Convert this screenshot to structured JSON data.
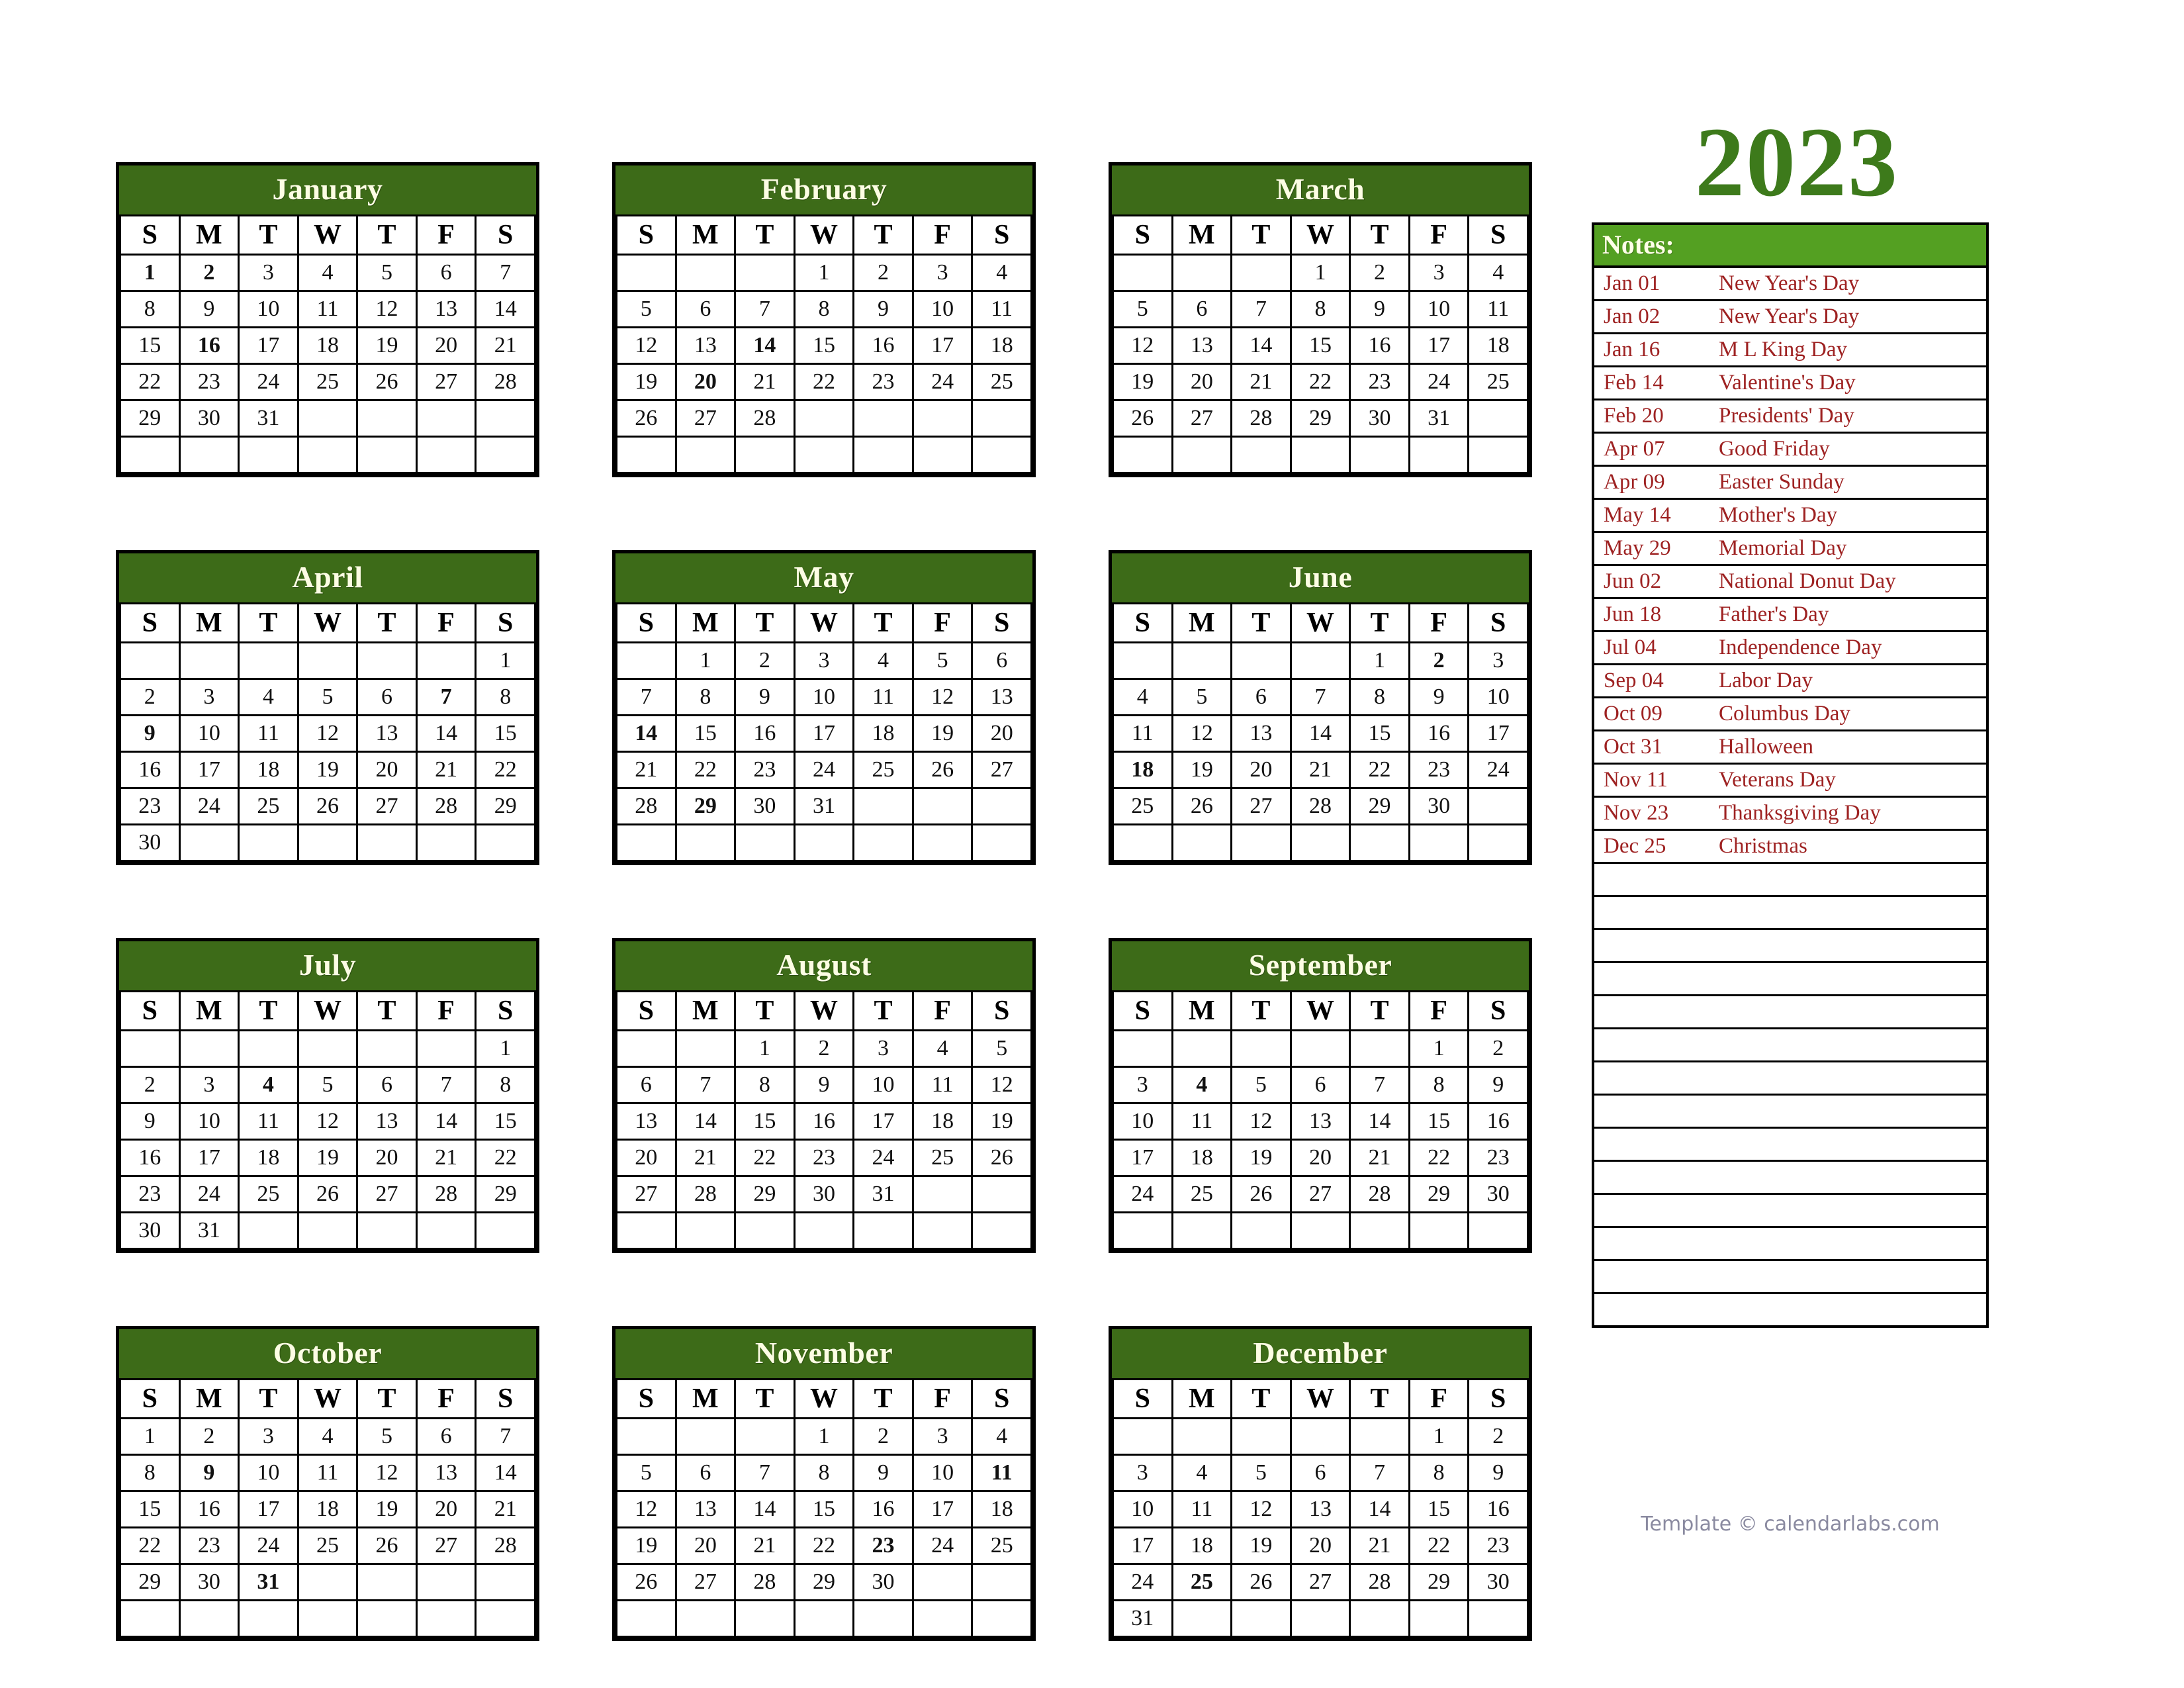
{
  "year_title": "2023",
  "colors": {
    "month_header_green": "#3d6b18",
    "notes_header_green": "#54a022",
    "year_green": "#3d7a1b",
    "weekend_green": "#3aa53a",
    "holiday_red": "#9e1b1b",
    "notes_text_red": "#9e2222"
  },
  "weekday_headers": [
    "S",
    "M",
    "T",
    "W",
    "T",
    "F",
    "S"
  ],
  "footer": "Template © calendarlabs.com",
  "notes": {
    "header": "Notes:",
    "entries": [
      {
        "date": "Jan 01",
        "label": "New Year's Day"
      },
      {
        "date": "Jan 02",
        "label": "New Year's Day"
      },
      {
        "date": "Jan 16",
        "label": "M L King Day"
      },
      {
        "date": "Feb 14",
        "label": "Valentine's Day"
      },
      {
        "date": "Feb 20",
        "label": "Presidents' Day"
      },
      {
        "date": "Apr 07",
        "label": "Good Friday"
      },
      {
        "date": "Apr 09",
        "label": "Easter Sunday"
      },
      {
        "date": "May 14",
        "label": "Mother's Day"
      },
      {
        "date": "May 29",
        "label": "Memorial Day"
      },
      {
        "date": "Jun 02",
        "label": "National Donut Day"
      },
      {
        "date": "Jun 18",
        "label": "Father's Day"
      },
      {
        "date": "Jul 04",
        "label": "Independence Day"
      },
      {
        "date": "Sep 04",
        "label": "Labor Day"
      },
      {
        "date": "Oct 09",
        "label": "Columbus Day"
      },
      {
        "date": "Oct 31",
        "label": "Halloween"
      },
      {
        "date": "Nov 11",
        "label": "Veterans Day"
      },
      {
        "date": "Nov 23",
        "label": "Thanksgiving Day"
      },
      {
        "date": "Dec 25",
        "label": "Christmas"
      }
    ],
    "blank_rows": 14
  },
  "months": [
    {
      "name": "January",
      "first_weekday": 0,
      "days": 31,
      "rows": 6,
      "holidays": [
        1,
        2,
        16
      ]
    },
    {
      "name": "February",
      "first_weekday": 3,
      "days": 28,
      "rows": 6,
      "holidays": [
        14,
        20
      ]
    },
    {
      "name": "March",
      "first_weekday": 3,
      "days": 31,
      "rows": 6,
      "holidays": []
    },
    {
      "name": "April",
      "first_weekday": 6,
      "days": 30,
      "rows": 6,
      "holidays": [
        7,
        9
      ]
    },
    {
      "name": "May",
      "first_weekday": 1,
      "days": 31,
      "rows": 6,
      "holidays": [
        14,
        29
      ]
    },
    {
      "name": "June",
      "first_weekday": 4,
      "days": 30,
      "rows": 6,
      "holidays": [
        2,
        18
      ]
    },
    {
      "name": "July",
      "first_weekday": 6,
      "days": 31,
      "rows": 6,
      "holidays": [
        4
      ]
    },
    {
      "name": "August",
      "first_weekday": 2,
      "days": 31,
      "rows": 6,
      "holidays": []
    },
    {
      "name": "September",
      "first_weekday": 5,
      "days": 30,
      "rows": 6,
      "holidays": [
        4
      ]
    },
    {
      "name": "October",
      "first_weekday": 0,
      "days": 31,
      "rows": 6,
      "holidays": [
        9,
        31
      ]
    },
    {
      "name": "November",
      "first_weekday": 3,
      "days": 30,
      "rows": 6,
      "holidays": [
        11,
        23
      ]
    },
    {
      "name": "December",
      "first_weekday": 5,
      "days": 31,
      "rows": 6,
      "holidays": [
        25
      ]
    }
  ]
}
